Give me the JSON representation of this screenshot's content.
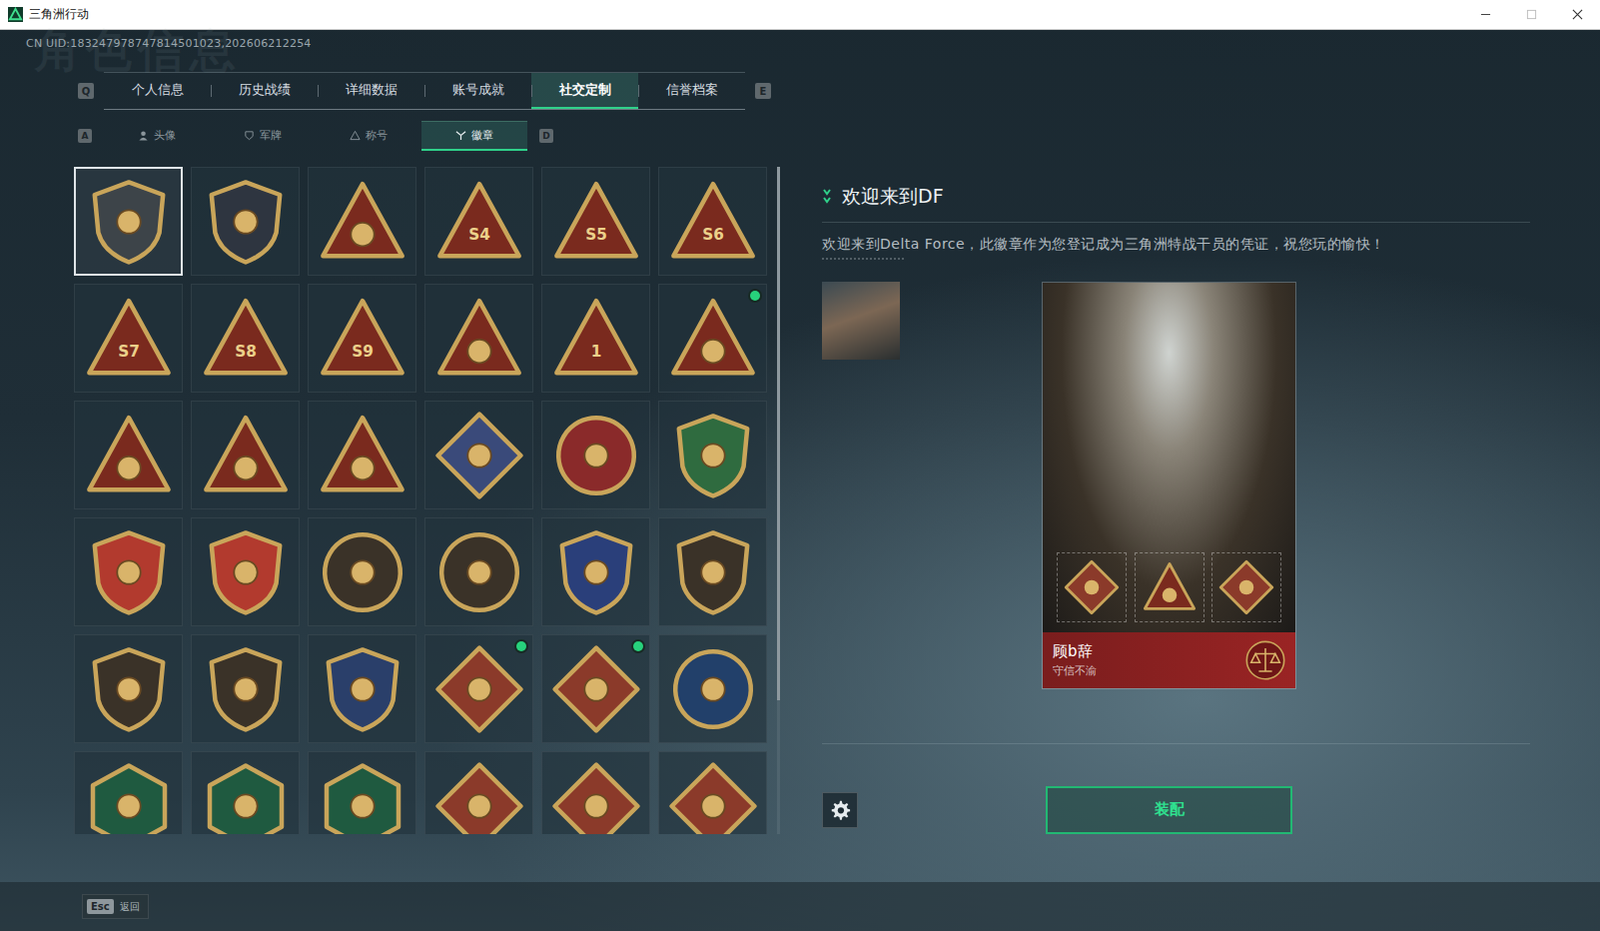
{
  "window": {
    "title": "三角洲行动"
  },
  "uid": "CN UID:183247978747814501023,202606212254",
  "watermark": "角色信息",
  "tabs": {
    "prev_key": "Q",
    "next_key": "E",
    "items": [
      {
        "label": "个人信息",
        "selected": false
      },
      {
        "label": "历史战绩",
        "selected": false
      },
      {
        "label": "详细数据",
        "selected": false
      },
      {
        "label": "账号成就",
        "selected": false
      },
      {
        "label": "社交定制",
        "selected": true
      },
      {
        "label": "信誉档案",
        "selected": false
      }
    ]
  },
  "subtabs": {
    "prev_key": "A",
    "next_key": "D",
    "items": [
      {
        "label": "头像",
        "kind": "avatar",
        "selected": false
      },
      {
        "label": "军牌",
        "kind": "tag",
        "selected": false
      },
      {
        "label": "称号",
        "kind": "title",
        "selected": false
      },
      {
        "label": "徽章",
        "kind": "badge",
        "selected": true
      }
    ]
  },
  "badges": {
    "scroll_level": 0.8,
    "items": [
      {
        "kind": "shield",
        "color": "#3d4449",
        "label": "",
        "selected": true,
        "new": false
      },
      {
        "kind": "shield",
        "color": "#2e3540",
        "label": "",
        "selected": false,
        "new": false
      },
      {
        "kind": "triangle",
        "color": "#7a2a1e",
        "label": "",
        "selected": false,
        "new": false
      },
      {
        "kind": "triangle",
        "color": "#7a2a1e",
        "label": "S4",
        "selected": false,
        "new": false
      },
      {
        "kind": "triangle",
        "color": "#7a2a1e",
        "label": "S5",
        "selected": false,
        "new": false
      },
      {
        "kind": "triangle",
        "color": "#7a2a1e",
        "label": "S6",
        "selected": false,
        "new": false
      },
      {
        "kind": "triangle",
        "color": "#7a2a1e",
        "label": "S7",
        "selected": false,
        "new": false
      },
      {
        "kind": "triangle",
        "color": "#7a2a1e",
        "label": "S8",
        "selected": false,
        "new": false
      },
      {
        "kind": "triangle",
        "color": "#7a2a1e",
        "label": "S9",
        "selected": false,
        "new": false
      },
      {
        "kind": "triangle",
        "color": "#7a2a1e",
        "label": "",
        "selected": false,
        "new": false
      },
      {
        "kind": "triangle",
        "color": "#7a2a1e",
        "label": "1",
        "selected": false,
        "new": false
      },
      {
        "kind": "triangle",
        "color": "#7a2a1e",
        "label": "",
        "selected": false,
        "new": true
      },
      {
        "kind": "triangle",
        "color": "#7a2a1e",
        "label": "",
        "selected": false,
        "new": false
      },
      {
        "kind": "triangle",
        "color": "#7a2a1e",
        "label": "",
        "selected": false,
        "new": false
      },
      {
        "kind": "triangle",
        "color": "#7a2a1e",
        "label": "",
        "selected": false,
        "new": false
      },
      {
        "kind": "diamond",
        "color": "#3a4a7a",
        "label": "",
        "selected": false,
        "new": false
      },
      {
        "kind": "circle",
        "color": "#8a2a2a",
        "label": "",
        "selected": false,
        "new": false
      },
      {
        "kind": "shield",
        "color": "#2f6b3f",
        "label": "",
        "selected": false,
        "new": false
      },
      {
        "kind": "shield",
        "color": "#b23a2e",
        "label": "",
        "selected": false,
        "new": false
      },
      {
        "kind": "shield",
        "color": "#b23a2e",
        "label": "",
        "selected": false,
        "new": false
      },
      {
        "kind": "circle",
        "color": "#3a3228",
        "label": "",
        "selected": false,
        "new": false
      },
      {
        "kind": "circle",
        "color": "#3a3228",
        "label": "",
        "selected": false,
        "new": false
      },
      {
        "kind": "shield",
        "color": "#2a3f7a",
        "label": "",
        "selected": false,
        "new": false
      },
      {
        "kind": "shield",
        "color": "#3a3228",
        "label": "",
        "selected": false,
        "new": false
      },
      {
        "kind": "shield",
        "color": "#3a3228",
        "label": "",
        "selected": false,
        "new": false
      },
      {
        "kind": "shield",
        "color": "#3a3228",
        "label": "",
        "selected": false,
        "new": false
      },
      {
        "kind": "shield",
        "color": "#2a3f6a",
        "label": "",
        "selected": false,
        "new": false
      },
      {
        "kind": "diamond",
        "color": "#8b3a2a",
        "label": "",
        "selected": false,
        "new": true
      },
      {
        "kind": "diamond",
        "color": "#8b3a2a",
        "label": "",
        "selected": false,
        "new": true
      },
      {
        "kind": "circle",
        "color": "#22406a",
        "label": "",
        "selected": false,
        "new": false
      },
      {
        "kind": "hexagon",
        "color": "#1f5a40",
        "label": "",
        "selected": false,
        "new": false
      },
      {
        "kind": "hexagon",
        "color": "#1f5a40",
        "label": "",
        "selected": false,
        "new": false
      },
      {
        "kind": "hexagon",
        "color": "#1f5a40",
        "label": "",
        "selected": false,
        "new": false
      },
      {
        "kind": "diamond",
        "color": "#8b3a2a",
        "label": "",
        "selected": false,
        "new": false
      },
      {
        "kind": "diamond",
        "color": "#8b3a2a",
        "label": "",
        "selected": false,
        "new": false
      },
      {
        "kind": "diamond",
        "color": "#8b3a2a",
        "label": "",
        "selected": false,
        "new": false
      }
    ]
  },
  "detail": {
    "title": "欢迎来到DF",
    "description": "欢迎来到Delta Force，此徽章作为您登记成为三角洲特战干员的凭证，祝您玩的愉快！",
    "card": {
      "name": "顾b辞",
      "motto": "守信不渝",
      "slots": [
        {
          "kind": "diamond",
          "color": "#8b3a2a"
        },
        {
          "kind": "triangle",
          "color": "#7a2a1e"
        },
        {
          "kind": "diamond",
          "color": "#8b3a2a"
        }
      ]
    },
    "equip_button": "装配"
  },
  "footer": {
    "key": "Esc",
    "label": "返回"
  }
}
